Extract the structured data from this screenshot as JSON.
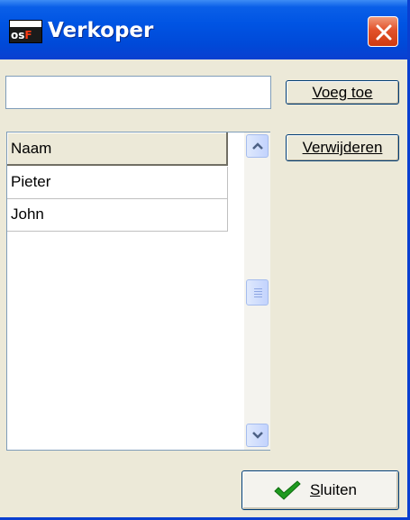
{
  "window": {
    "title": "Verkoper",
    "logo_text_white": "os",
    "logo_text_red": "F"
  },
  "form": {
    "name_input_value": "",
    "add_button_label": "Voeg toe",
    "remove_button_label": "Verwijderen"
  },
  "grid": {
    "column_header": "Naam",
    "rows": [
      "Pieter",
      "John"
    ]
  },
  "footer": {
    "close_button_mnemonic": "S",
    "close_button_rest": "luiten"
  },
  "icons": {
    "close": "close-icon",
    "check": "check-icon",
    "scroll_up": "scroll-up-arrow-icon",
    "scroll_down": "scroll-down-arrow-icon"
  },
  "colors": {
    "title_bar": "#0054e3",
    "window_bg": "#ece9d8",
    "close_button": "#e2522a",
    "check_green": "#1f9a1f"
  }
}
